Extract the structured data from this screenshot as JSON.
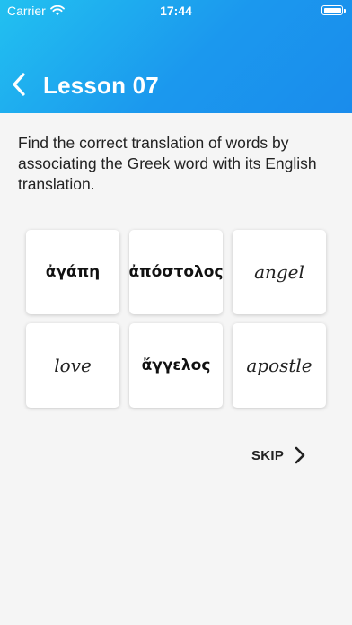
{
  "status_bar": {
    "carrier": "Carrier",
    "time": "17:44"
  },
  "header": {
    "title": "Lesson 07",
    "back_icon": "chevron-left-icon"
  },
  "instructions": "Find the correct translation of words by associating the Greek word with its English translation.",
  "tiles": [
    {
      "text": "ἀγάπη",
      "kind": "greek"
    },
    {
      "text": "ἀπόστολος",
      "kind": "greek"
    },
    {
      "text": "angel",
      "kind": "english"
    },
    {
      "text": "love",
      "kind": "english"
    },
    {
      "text": "ἄγγελος",
      "kind": "greek"
    },
    {
      "text": "apostle",
      "kind": "english"
    }
  ],
  "skip": {
    "label": "SKIP",
    "icon": "chevron-right-icon"
  },
  "colors": {
    "header_gradient_start": "#22c1f0",
    "header_gradient_end": "#1a8cec",
    "background": "#f5f5f5",
    "tile_background": "#ffffff",
    "text": "#222222"
  }
}
